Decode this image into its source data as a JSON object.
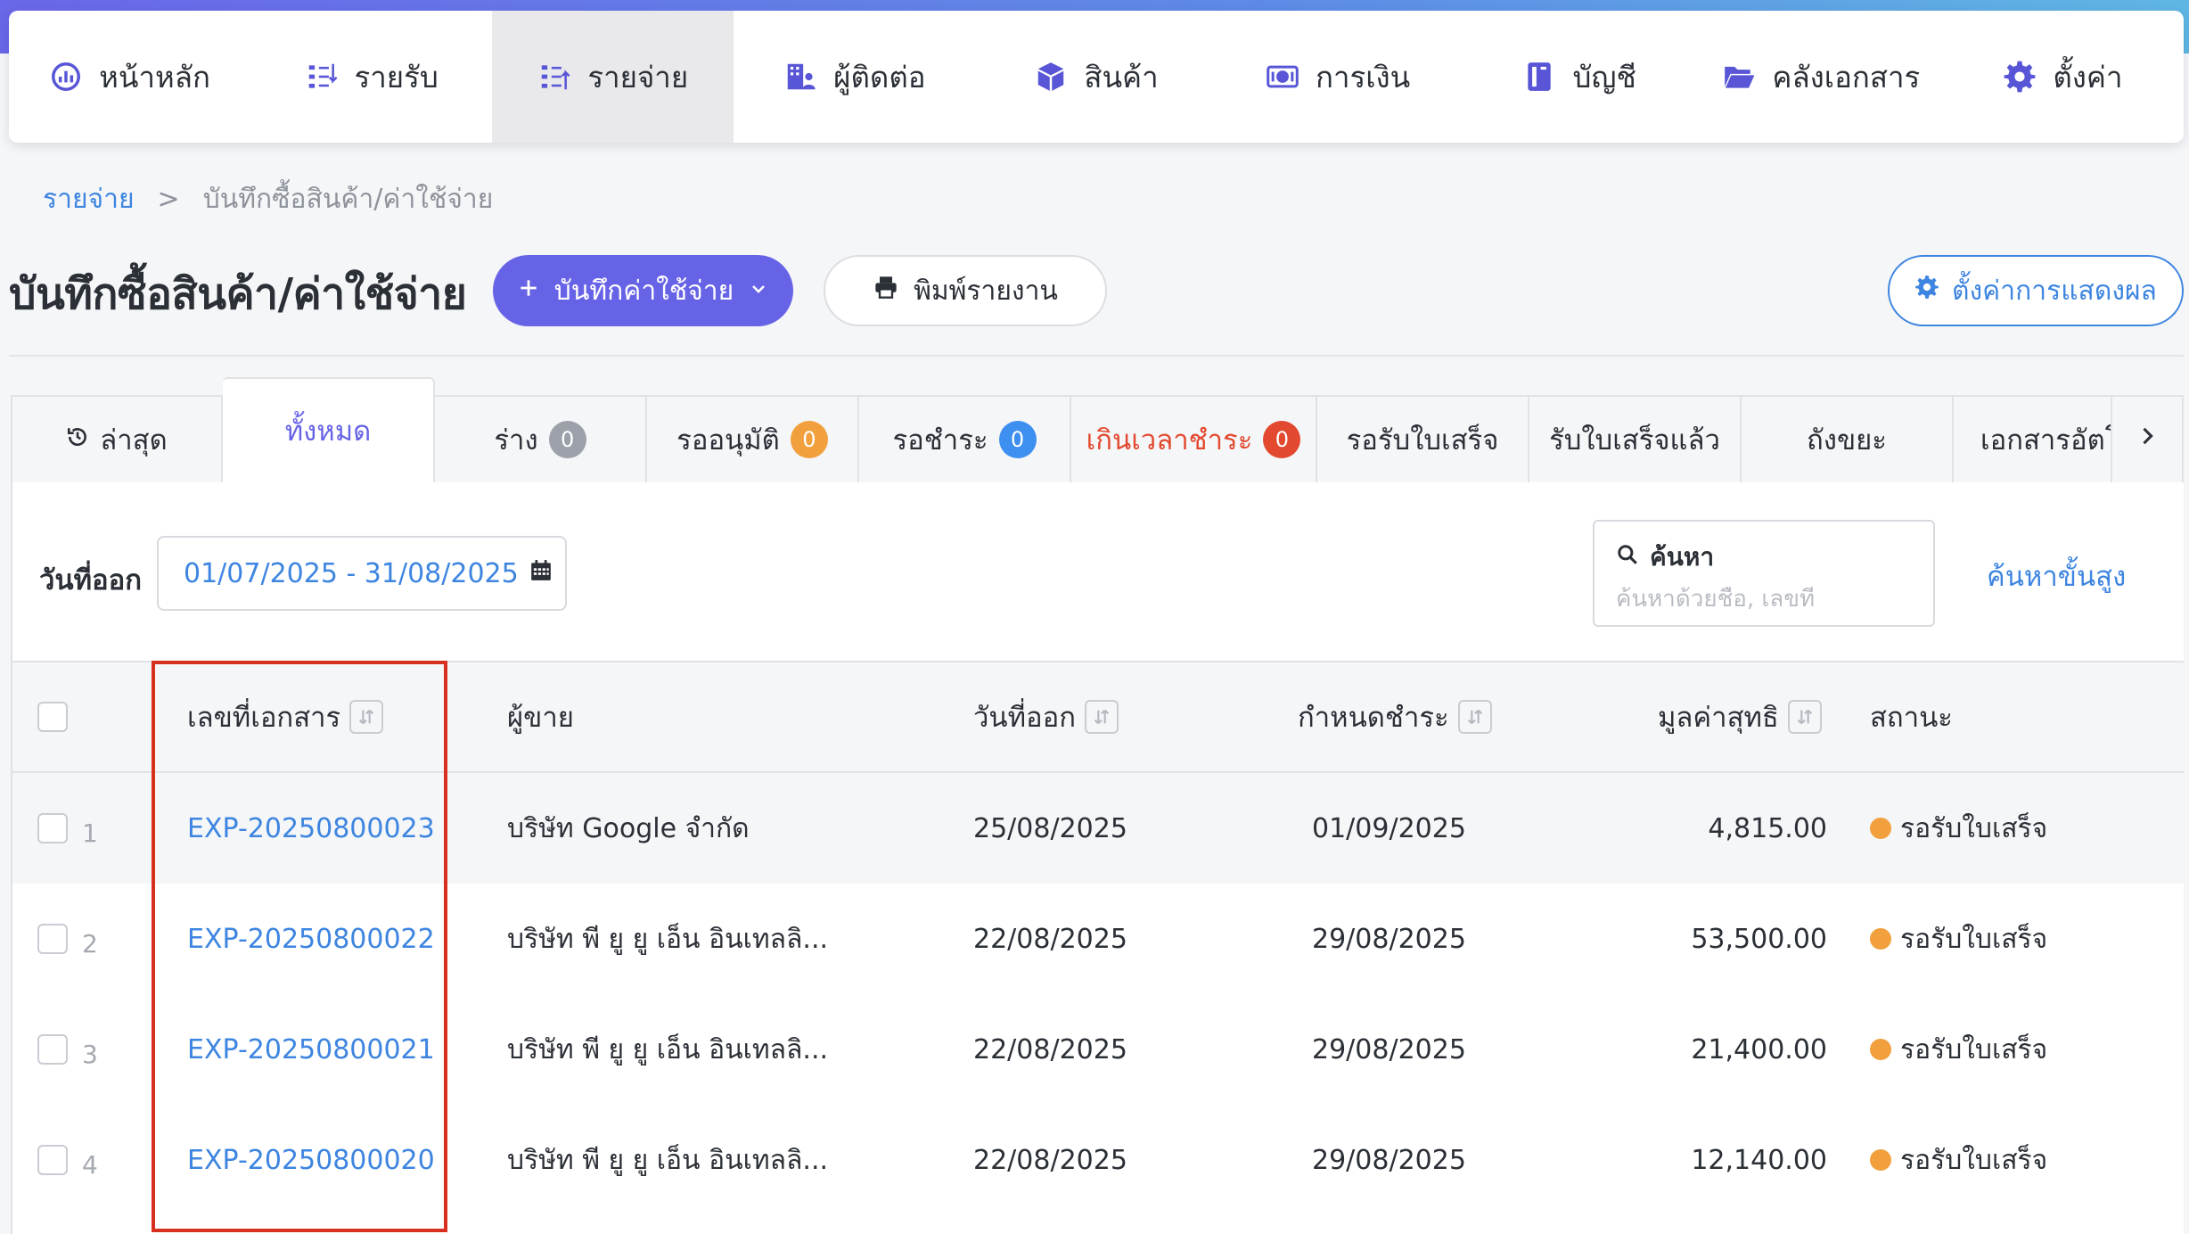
{
  "colors": {
    "accent": "#6763e6",
    "link": "#3d85e0",
    "overdue": "#e2492f",
    "status_pending": "#f2a03d",
    "highlight": "#d8301f"
  },
  "nav": {
    "items": [
      {
        "label": "หน้าหลัก",
        "icon": "dashboard-icon"
      },
      {
        "label": "รายรับ",
        "icon": "income-icon"
      },
      {
        "label": "รายจ่าย",
        "icon": "expense-icon",
        "active": true
      },
      {
        "label": "ผู้ติดต่อ",
        "icon": "contacts-icon"
      },
      {
        "label": "สินค้า",
        "icon": "box-icon"
      },
      {
        "label": "การเงิน",
        "icon": "money-icon"
      },
      {
        "label": "บัญชี",
        "icon": "ledger-icon"
      },
      {
        "label": "คลังเอกสาร",
        "icon": "folder-icon"
      },
      {
        "label": "ตั้งค่า",
        "icon": "gear-icon"
      }
    ]
  },
  "breadcrumb": {
    "parent": "รายจ่าย",
    "separator": ">",
    "current": "บันทึกซื้อสินค้า/ค่าใช้จ่าย"
  },
  "page": {
    "title": "บันทึกซื้อสินค้า/ค่าใช้จ่าย"
  },
  "toolbar": {
    "add_label": "บันทึกค่าใช้จ่าย",
    "print_label": "พิมพ์รายงาน",
    "display_settings_label": "ตั้งค่าการแสดงผล"
  },
  "tabs": [
    {
      "label": "ล่าสุด",
      "icon": "history-icon"
    },
    {
      "label": "ทั้งหมด",
      "active": true
    },
    {
      "label": "ร่าง",
      "count": "0",
      "badge": "gray"
    },
    {
      "label": "รออนุมัติ",
      "count": "0",
      "badge": "orange"
    },
    {
      "label": "รอชำระ",
      "count": "0",
      "badge": "blue"
    },
    {
      "label": "เกินเวลาชำระ",
      "count": "0",
      "badge": "red"
    },
    {
      "label": "รอรับใบเสร็จ"
    },
    {
      "label": "รับใบเสร็จแล้ว"
    },
    {
      "label": "ถังขยะ"
    },
    {
      "label": "เอกสารอัตโเ"
    }
  ],
  "filter": {
    "date_label": "วันที่ออก",
    "date_range": "01/07/2025 - 31/08/2025",
    "search_title": "ค้นหา",
    "search_placeholder": "ค้นหาด้วยชื่อ, เลขที่",
    "advanced_search_label": "ค้นหาขั้นสูง"
  },
  "table": {
    "columns": {
      "doc_no": "เลขที่เอกสาร",
      "vendor": "ผู้ขาย",
      "issue_date": "วันที่ออก",
      "due_date": "กำหนดชำระ",
      "net_value": "มูลค่าสุทธิ",
      "status": "สถานะ"
    },
    "rows": [
      {
        "num": "1",
        "doc_no": "EXP-20250800023",
        "vendor": "บริษัท Google จำกัด",
        "issue_date": "25/08/2025",
        "due_date": "01/09/2025",
        "net_value": "4,815.00",
        "status": "รอรับใบเสร็จ"
      },
      {
        "num": "2",
        "doc_no": "EXP-20250800022",
        "vendor": "บริษัท พี ยู ยู เอ็น อินเทลลิ...",
        "issue_date": "22/08/2025",
        "due_date": "29/08/2025",
        "net_value": "53,500.00",
        "status": "รอรับใบเสร็จ"
      },
      {
        "num": "3",
        "doc_no": "EXP-20250800021",
        "vendor": "บริษัท พี ยู ยู เอ็น อินเทลลิ...",
        "issue_date": "22/08/2025",
        "due_date": "29/08/2025",
        "net_value": "21,400.00",
        "status": "รอรับใบเสร็จ"
      },
      {
        "num": "4",
        "doc_no": "EXP-20250800020",
        "vendor": "บริษัท พี ยู ยู เอ็น อินเทลลิ...",
        "issue_date": "22/08/2025",
        "due_date": "29/08/2025",
        "net_value": "12,140.00",
        "status": "รอรับใบเสร็จ"
      }
    ]
  }
}
